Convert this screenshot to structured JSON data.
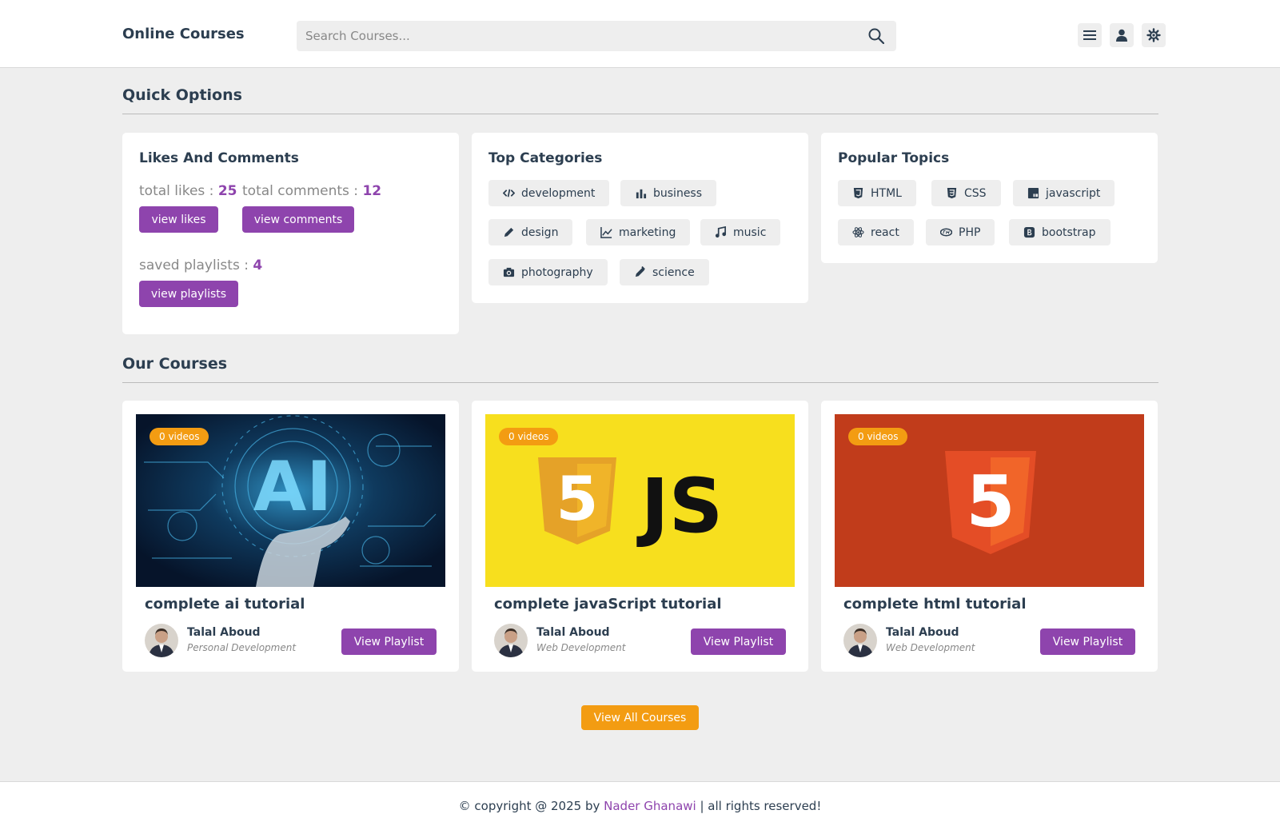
{
  "header": {
    "logo": "Online Courses",
    "search_placeholder": "Search Courses..."
  },
  "quick_options": {
    "title": "Quick Options",
    "likes_card": {
      "title": "Likes And Comments",
      "likes_label": "total likes :",
      "likes_value": "25",
      "comments_label": "total comments :",
      "comments_value": "12",
      "view_likes": "view likes",
      "view_comments": "view comments",
      "playlists_label": "saved playlists :",
      "playlists_value": "4",
      "view_playlists": "view playlists"
    },
    "categories_card": {
      "title": "Top Categories",
      "items": [
        {
          "label": "development",
          "icon": "code-icon"
        },
        {
          "label": "business",
          "icon": "bar-chart-icon"
        },
        {
          "label": "design",
          "icon": "pen-icon"
        },
        {
          "label": "marketing",
          "icon": "line-chart-icon"
        },
        {
          "label": "music",
          "icon": "music-icon"
        },
        {
          "label": "photography",
          "icon": "camera-icon"
        },
        {
          "label": "science",
          "icon": "vial-icon"
        }
      ]
    },
    "topics_card": {
      "title": "Popular Topics",
      "items": [
        {
          "label": "HTML",
          "icon": "html5-icon"
        },
        {
          "label": "CSS",
          "icon": "css3-icon"
        },
        {
          "label": "javascript",
          "icon": "js-icon"
        },
        {
          "label": "react",
          "icon": "react-icon"
        },
        {
          "label": "PHP",
          "icon": "php-icon"
        },
        {
          "label": "bootstrap",
          "icon": "bootstrap-icon"
        }
      ]
    }
  },
  "courses": {
    "title": "Our Courses",
    "items": [
      {
        "badge": "0 videos",
        "title": "complete ai tutorial",
        "tutor": "Talal Aboud",
        "category": "Personal Development",
        "button": "View Playlist"
      },
      {
        "badge": "0 videos",
        "title": "complete javaScript tutorial",
        "tutor": "Talal Aboud",
        "category": "Web Development",
        "button": "View Playlist"
      },
      {
        "badge": "0 videos",
        "title": "complete html tutorial",
        "tutor": "Talal Aboud",
        "category": "Web Development",
        "button": "View Playlist"
      }
    ],
    "view_all": "View All Courses",
    "thumb_text": {
      "ai": "AI",
      "js": "JS",
      "five": "5"
    }
  },
  "footer": {
    "prefix": "© copyright @ 2025 by",
    "author": "Nader Ghanawi",
    "suffix": "| all rights reserved!"
  },
  "colors": {
    "accent": "#8e44ad",
    "orange": "#f39c12",
    "text": "#2c3e50",
    "background": "#eeeeee"
  }
}
